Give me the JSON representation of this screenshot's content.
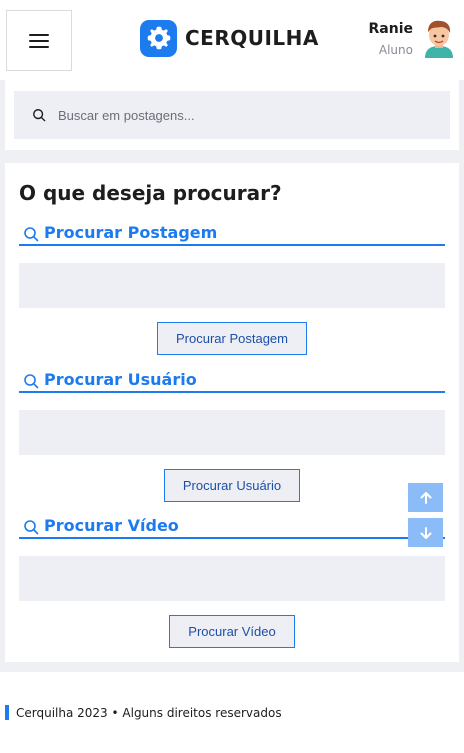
{
  "header": {
    "brand": "CERQUILHA",
    "user_name": "Ranie",
    "user_role": "Aluno",
    "icons": {
      "menu": "hamburger-icon",
      "logo": "gear-icon",
      "avatar": "avatar"
    }
  },
  "search": {
    "placeholder": "Buscar em postagens...",
    "icon": "search-icon"
  },
  "main": {
    "heading": "O que deseja procurar?",
    "sections": [
      {
        "title": "Procurar Postagem",
        "button": "Procurar Postagem",
        "value": ""
      },
      {
        "title": "Procurar Usuário",
        "button": "Procurar Usuário",
        "value": ""
      },
      {
        "title": "Procurar Vídeo",
        "button": "Procurar Vídeo",
        "value": ""
      }
    ]
  },
  "scroll": {
    "up_icon": "arrow-up-icon",
    "down_icon": "arrow-down-icon"
  },
  "footer": {
    "text": "Cerquilha 2023 • Alguns direitos reservados"
  },
  "colors": {
    "accent": "#1d7bf0",
    "field_bg": "#eeeef5",
    "page_bg": "#eef0f4",
    "scroll_btn": "#8bbcf7"
  }
}
